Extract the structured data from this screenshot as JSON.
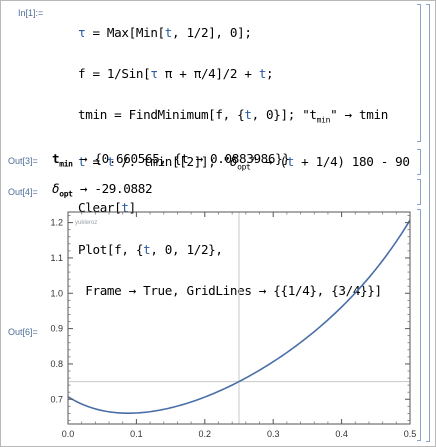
{
  "input": {
    "label": "In[1]:=",
    "lines": [
      "τ = Max[Min[t, 1/2], 0];",
      "f = 1/Sin[τ π + π/4]/2 + t;",
      "tmin = FindMinimum[f, {t, 0}]; \"tmin\" → tmin",
      "t = t /. tmin[[2]]; \"δopt\" → (t + 1/4) 180 - 90",
      "Clear[t]",
      "Plot[f, {t, 0, 1/2},",
      " Frame → True, GridLines → {{1/4}, {3/4}}]"
    ]
  },
  "out3": {
    "label": "Out[3]=",
    "key": "tmin",
    "text": " → {0.660565, {t → 0.0883986}}"
  },
  "out4": {
    "label": "Out[4]=",
    "key": "δopt",
    "text": " → -29.0882"
  },
  "out6": {
    "label": "Out[6]=",
    "watermark": "yukleroz"
  },
  "chart_data": {
    "type": "line",
    "function": "1/(2 sin(πt + π/4)) + t",
    "x_domain": [
      0,
      0.5
    ],
    "xlim": [
      0,
      0.5
    ],
    "ylim": [
      0.63,
      1.23
    ],
    "x_ticks": [
      "0.0",
      "0.1",
      "0.2",
      "0.3",
      "0.4",
      "0.5"
    ],
    "y_ticks": [
      "0.7",
      "0.8",
      "0.9",
      "1.0",
      "1.1",
      "1.2"
    ],
    "gridlines": {
      "x": [
        0.25
      ],
      "y": [
        0.75
      ]
    },
    "minimum": {
      "x": 0.0883986,
      "y": 0.660565
    },
    "colors": {
      "curve": "#4a6fa8",
      "grid": "#c8c8c8",
      "label": "#4e6e97"
    }
  }
}
